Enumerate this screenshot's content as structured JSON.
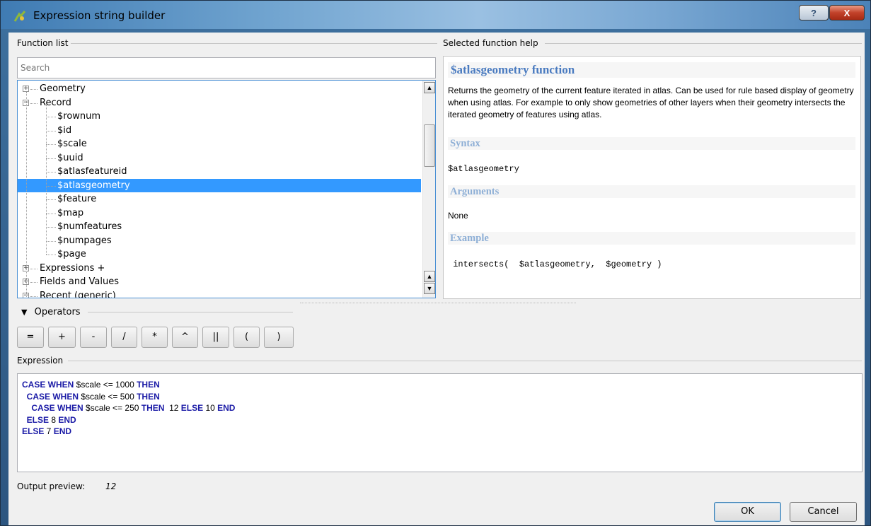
{
  "window": {
    "title": "Expression string builder",
    "help_glyph": "?",
    "close_glyph": "X"
  },
  "function_list": {
    "group_label": "Function list",
    "search_placeholder": "Search",
    "tree": [
      {
        "label": "Geometry",
        "expander": "+"
      },
      {
        "label": "Record",
        "expander": "−"
      },
      {
        "label": "$rownum"
      },
      {
        "label": "$id"
      },
      {
        "label": "$scale"
      },
      {
        "label": "$uuid"
      },
      {
        "label": "$atlasfeatureid"
      },
      {
        "label": "$atlasgeometry",
        "selected": true
      },
      {
        "label": "$feature"
      },
      {
        "label": "$map"
      },
      {
        "label": "$numfeatures"
      },
      {
        "label": "$numpages"
      },
      {
        "label": "$page"
      },
      {
        "label": "Expressions +",
        "expander": "+"
      },
      {
        "label": "Fields and Values",
        "expander": "+"
      },
      {
        "label": "Recent (generic)",
        "expander": "−"
      }
    ]
  },
  "help": {
    "group_label": "Selected function help",
    "title": "$atlasgeometry function",
    "description": "Returns the geometry of the current feature iterated in atlas. Can be used for rule based display of geometry when using atlas. For example to only show geometries of other layers when their geometry intersects the iterated geometry of features using atlas.",
    "syntax_heading": "Syntax",
    "syntax": "$atlasgeometry",
    "arguments_heading": "Arguments",
    "arguments": "None",
    "example_heading": "Example",
    "example": " intersects(  $atlasgeometry,  $geometry )"
  },
  "operators": {
    "label": "Operators",
    "toggle_glyph": "▼",
    "buttons": [
      "=",
      "+",
      "-",
      "/",
      "*",
      "^",
      "||",
      "(",
      ")"
    ]
  },
  "expression": {
    "group_label": "Expression",
    "lines": [
      [
        {
          "t": "CASE WHEN",
          "kw": true
        },
        {
          "t": " $scale <= 1000 "
        },
        {
          "t": "THEN",
          "kw": true
        }
      ],
      [
        {
          "t": "  "
        },
        {
          "t": "CASE WHEN",
          "kw": true
        },
        {
          "t": " $scale <= 500 "
        },
        {
          "t": "THEN",
          "kw": true
        }
      ],
      [
        {
          "t": "    "
        },
        {
          "t": "CASE WHEN",
          "kw": true
        },
        {
          "t": " $scale <= 250 "
        },
        {
          "t": "THEN",
          "kw": true
        },
        {
          "t": "  12 "
        },
        {
          "t": "ELSE",
          "kw": true
        },
        {
          "t": " 10 "
        },
        {
          "t": "END",
          "kw": true
        }
      ],
      [
        {
          "t": "  "
        },
        {
          "t": "ELSE",
          "kw": true
        },
        {
          "t": " 8 "
        },
        {
          "t": "END",
          "kw": true
        }
      ],
      [
        {
          "t": "ELSE",
          "kw": true
        },
        {
          "t": " 7 "
        },
        {
          "t": "END",
          "kw": true
        }
      ]
    ]
  },
  "output_preview": {
    "label": "Output preview:",
    "value": "12"
  },
  "dialog_buttons": {
    "ok": "OK",
    "cancel": "Cancel"
  }
}
